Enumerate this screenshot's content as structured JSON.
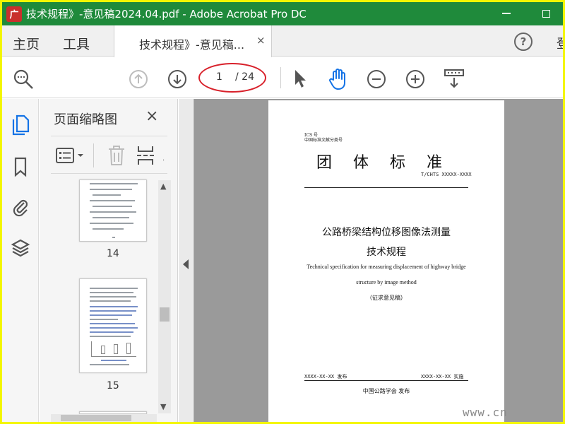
{
  "window": {
    "logo_text": "广",
    "title": "技术规程》-意见稿2024.04.pdf - Adobe Acrobat Pro DC"
  },
  "menu": {
    "home": "主页",
    "tools": "工具",
    "doc_tab": "技术规程》-意见稿...",
    "tab_close": "×",
    "help": "?",
    "login_fragment": "登"
  },
  "toolbar": {
    "current_page": "1",
    "total_pages": "/ 24",
    "annotation_color": "#d8202a"
  },
  "thumbnail_panel": {
    "title": "页面缩略图",
    "close": "×",
    "thumbnails": [
      {
        "page": "14"
      },
      {
        "page": "15"
      }
    ]
  },
  "document": {
    "ics": "ICS 号",
    "classification": "中国标准文献分类号",
    "heading": "团体标准",
    "code": "T/CHTS XXXXX-XXXX",
    "title_line1": "公路桥梁结构位移图像法测量",
    "title_line2": "技术规程",
    "english_line1": "Technical specification for measuring displacement of highway bridge",
    "english_line2": "structure by image method",
    "draft_label": "（征求意见稿）",
    "issue_date": "XXXX-XX-XX 发布",
    "implement_date": "XXXX-XX-XX 实施",
    "publisher": "中国公路学会  发布"
  },
  "watermark": "www.cn",
  "colors": {
    "titlebar": "#1f8a3b",
    "frame": "#f3f600",
    "accent_blue": "#1473e6"
  }
}
